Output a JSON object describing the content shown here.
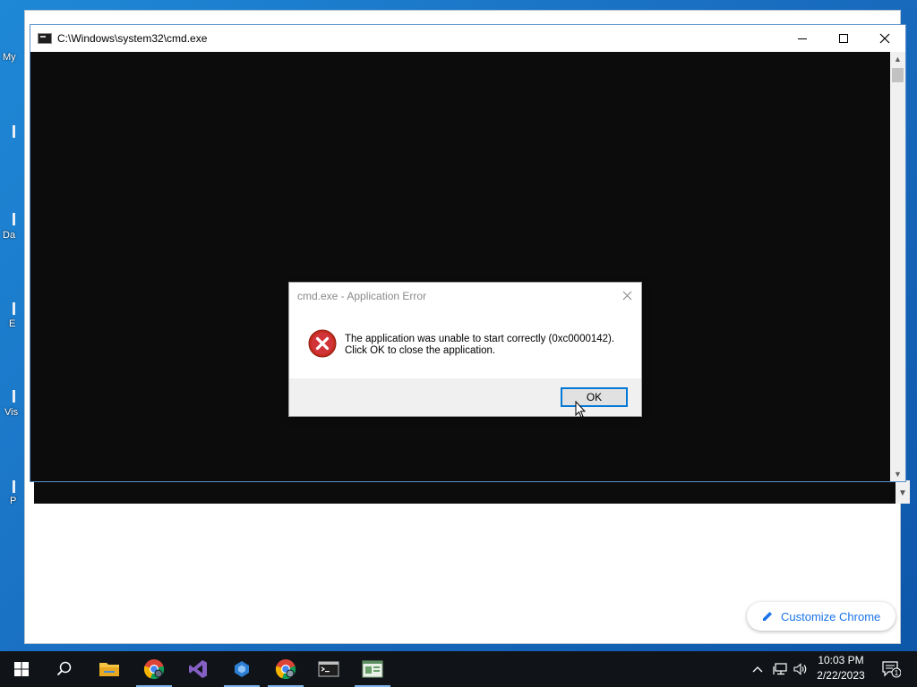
{
  "desktop": {
    "icon_labels": [
      "My",
      "Da",
      "E",
      "Vis",
      "P"
    ]
  },
  "chrome": {
    "customize_label": "Customize Chrome"
  },
  "cmd_window": {
    "title": "C:\\Windows\\system32\\cmd.exe"
  },
  "dialog": {
    "title": "cmd.exe - Application Error",
    "message_line1": "The application was unable to start correctly (0xc0000142).",
    "message_line2": "Click OK to close the application.",
    "ok_label": "OK"
  },
  "taskbar": {
    "apps": [
      {
        "name": "file-explorer"
      },
      {
        "name": "chrome"
      },
      {
        "name": "visual-studio"
      },
      {
        "name": "app-blue"
      },
      {
        "name": "chrome-2"
      },
      {
        "name": "command-prompt"
      },
      {
        "name": "app-window"
      }
    ],
    "time": "10:03 PM",
    "date": "2/22/2023",
    "notification_count": "1"
  }
}
